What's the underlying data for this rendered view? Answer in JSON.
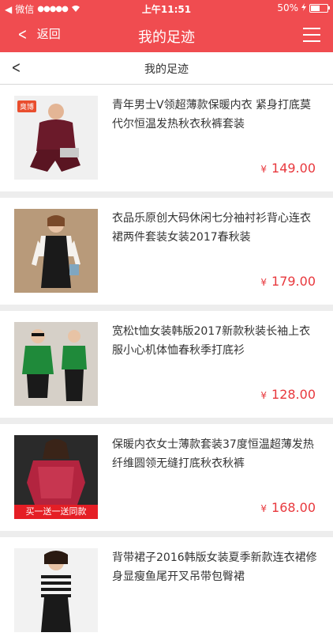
{
  "status_bar": {
    "carrier": "微信",
    "signal": "●●●●●",
    "time": "上午11:51",
    "battery": "50%"
  },
  "nav": {
    "back_label": "返回",
    "title": "我的足迹"
  },
  "subheader": {
    "title": "我的足迹"
  },
  "items": [
    {
      "title": "青年男士V领超薄款保暖内衣 紧身打底莫代尔恒温发热秋衣秋裤套装",
      "currency": "¥",
      "price": "149.00",
      "badge": "臭博"
    },
    {
      "title": "衣品乐原创大码休闲七分袖衬衫背心连衣裙两件套装女装2017春秋装",
      "currency": "¥",
      "price": "179.00"
    },
    {
      "title": "宽松t恤女装韩版2017新款秋装长袖上衣服小心机体恤春秋季打底衫",
      "currency": "¥",
      "price": "128.00"
    },
    {
      "title": "保暖内衣女士薄款套装37度恒温超薄发热纤维圆领无缝打底秋衣秋裤",
      "currency": "¥",
      "price": "168.00",
      "promo": "买一送一送同款"
    },
    {
      "title": "背带裙子2016韩版女装夏季新款连衣裙修身显瘦鱼尾开叉吊带包臀裙",
      "currency": "¥",
      "price": ""
    }
  ]
}
